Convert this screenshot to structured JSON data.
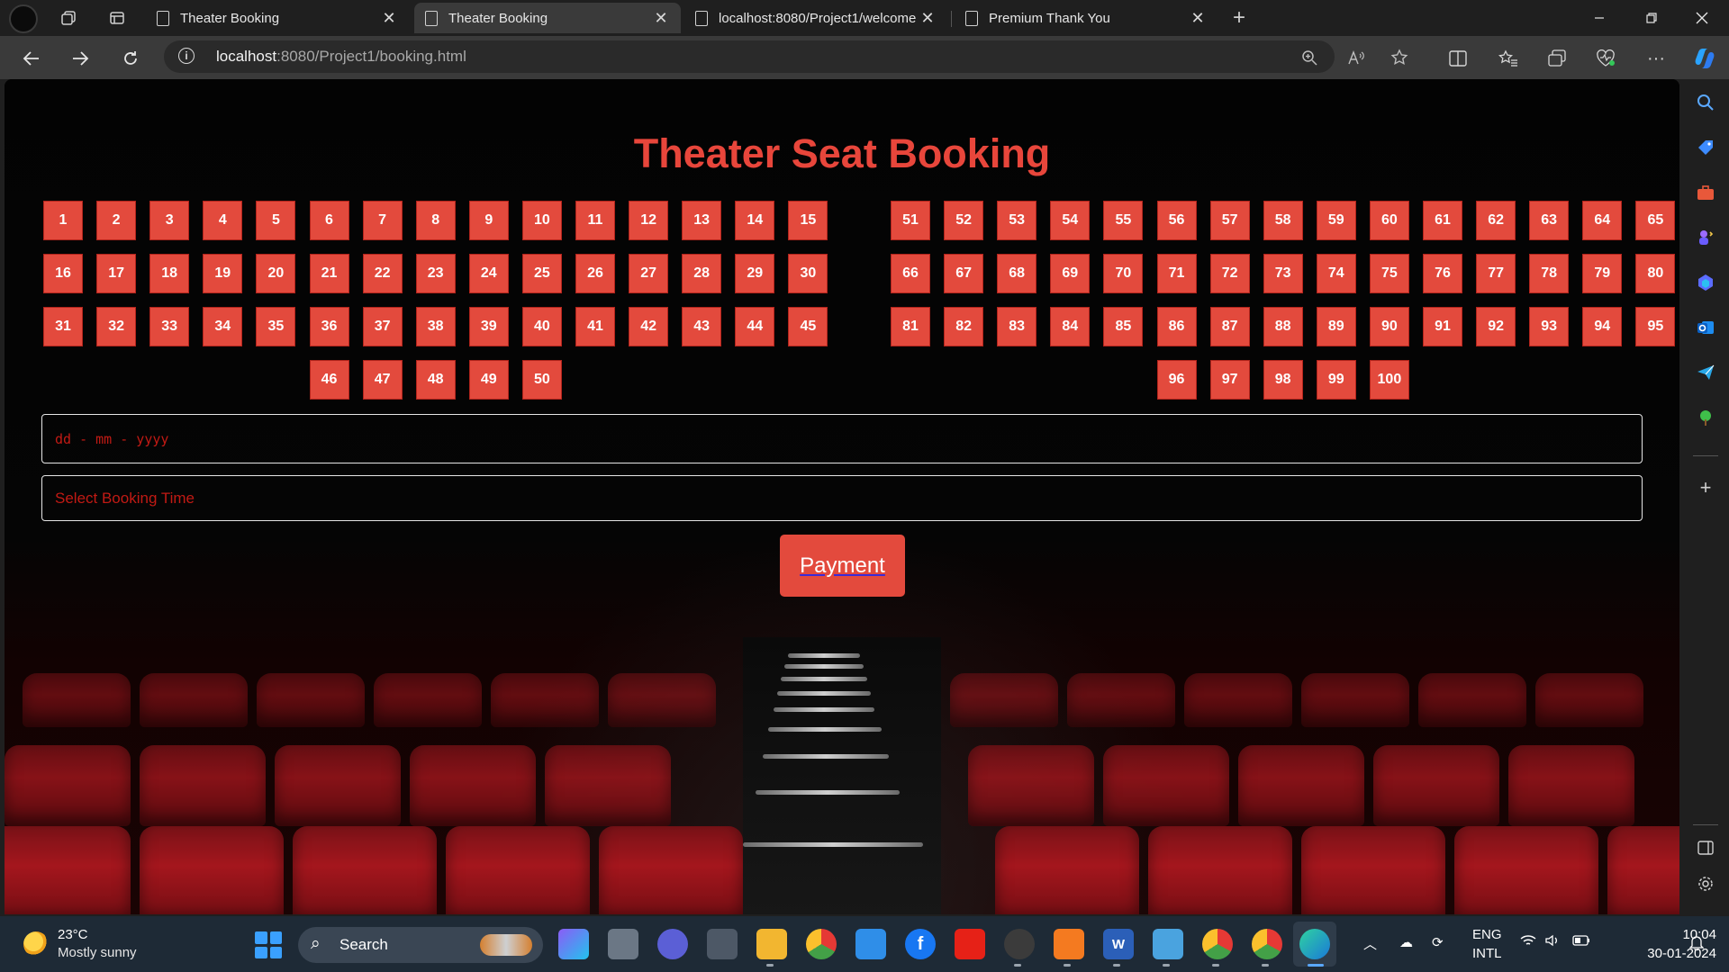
{
  "browser": {
    "tabs": [
      {
        "title": "Theater Booking",
        "active": false
      },
      {
        "title": "Theater Booking",
        "active": true
      },
      {
        "title": "localhost:8080/Project1/welcome",
        "active": false
      },
      {
        "title": "Premium Thank You",
        "active": false
      }
    ],
    "close_glyph": "✕",
    "new_tab_glyph": "+",
    "url_host": "localhost",
    "url_path": ":8080/Project1/booking.html"
  },
  "page": {
    "title": "Theater Seat Booking",
    "left_block": {
      "rows": [
        [
          1,
          2,
          3,
          4,
          5,
          6,
          7,
          8,
          9,
          10,
          11,
          12,
          13,
          14,
          15
        ],
        [
          16,
          17,
          18,
          19,
          20,
          21,
          22,
          23,
          24,
          25,
          26,
          27,
          28,
          29,
          30
        ],
        [
          31,
          32,
          33,
          34,
          35,
          36,
          37,
          38,
          39,
          40,
          41,
          42,
          43,
          44,
          45
        ],
        [
          46,
          47,
          48,
          49,
          50
        ]
      ]
    },
    "right_block": {
      "rows": [
        [
          51,
          52,
          53,
          54,
          55,
          56,
          57,
          58,
          59,
          60,
          61,
          62,
          63,
          64,
          65
        ],
        [
          66,
          67,
          68,
          69,
          70,
          71,
          72,
          73,
          74,
          75,
          76,
          77,
          78,
          79,
          80
        ],
        [
          81,
          82,
          83,
          84,
          85,
          86,
          87,
          88,
          89,
          90,
          91,
          92,
          93,
          94,
          95
        ],
        [
          96,
          97,
          98,
          99,
          100
        ]
      ]
    },
    "date_placeholder": "dd - mm - yyyy",
    "time_placeholder": "Select Booking Time",
    "payment_label": "Payment",
    "accent_color": "#e34a3d"
  },
  "taskbar": {
    "temperature": "23°C",
    "weather": "Mostly sunny",
    "search_label": "Search",
    "lang_line1": "ENG",
    "lang_line2": "INTL",
    "time": "10:04",
    "date": "30-01-2024"
  }
}
